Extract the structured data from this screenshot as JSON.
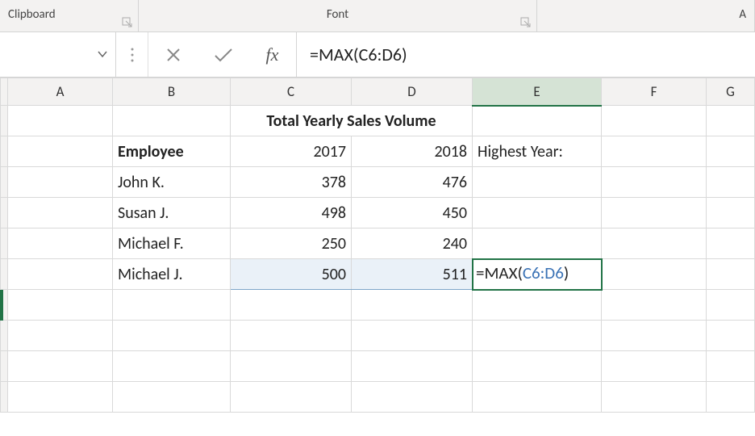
{
  "ribbon": {
    "clipboard_label": "Clipboard",
    "font_label": "Font",
    "alignment_label": "A"
  },
  "formula_bar": {
    "name_box": "",
    "formula": "=MAX(C6:D6)"
  },
  "columns": {
    "A": "A",
    "B": "B",
    "C": "C",
    "D": "D",
    "E": "E",
    "F": "F",
    "G": "G"
  },
  "cells": {
    "title": "Total Yearly Sales Volume",
    "B2": "Employee",
    "C2": "2017",
    "D2": "2018",
    "E2": "Highest Year:",
    "B3": "John K.",
    "C3": "378",
    "D3": "476",
    "B4": "Susan J.",
    "C4": "498",
    "D4": "450",
    "B5": "Michael F.",
    "C5": "250",
    "D5": "240",
    "B6": "Michael J.",
    "C6": "500",
    "D6": "511",
    "E6_prefix": "=MAX(",
    "E6_ref": "C6:D6",
    "E6_suffix": ")"
  },
  "chart_data": {
    "type": "table",
    "title": "Total Yearly Sales Volume",
    "columns": [
      "Employee",
      "2017",
      "2018"
    ],
    "rows": [
      {
        "Employee": "John K.",
        "2017": 378,
        "2018": 476
      },
      {
        "Employee": "Susan J.",
        "2017": 498,
        "2018": 450
      },
      {
        "Employee": "Michael F.",
        "2017": 250,
        "2018": 240
      },
      {
        "Employee": "Michael J.",
        "2017": 500,
        "2018": 511
      }
    ],
    "formula_cell": {
      "address": "E6",
      "formula": "=MAX(C6:D6)"
    }
  }
}
